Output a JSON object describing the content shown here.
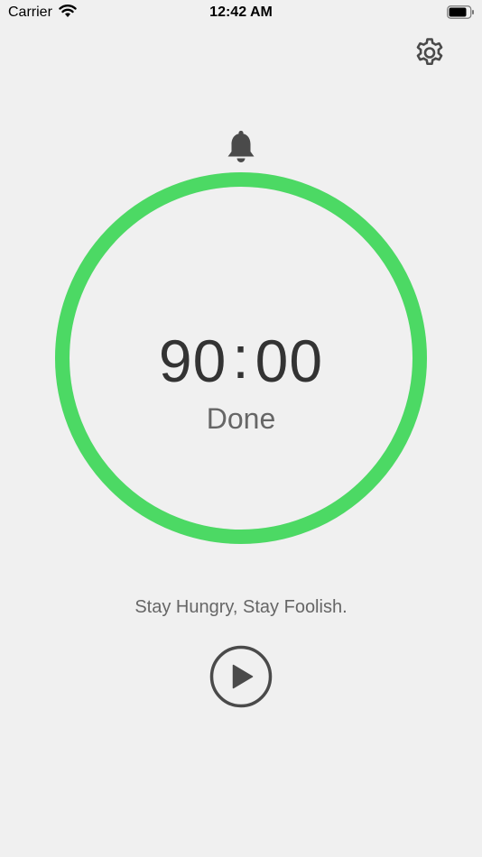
{
  "status_bar": {
    "carrier": "Carrier",
    "time": "12:42 AM"
  },
  "timer": {
    "minutes": "90",
    "separator": ":",
    "seconds": "00",
    "status": "Done",
    "progress": 1.0
  },
  "quote": "Stay Hungry, Stay Foolish.",
  "icons": {
    "settings": "gear-icon",
    "alarm": "bell-icon",
    "play": "play-icon"
  },
  "colors": {
    "background": "#f0f0f0",
    "ring": "#4cd964",
    "text_dark": "#333333",
    "text_muted": "#666666"
  }
}
